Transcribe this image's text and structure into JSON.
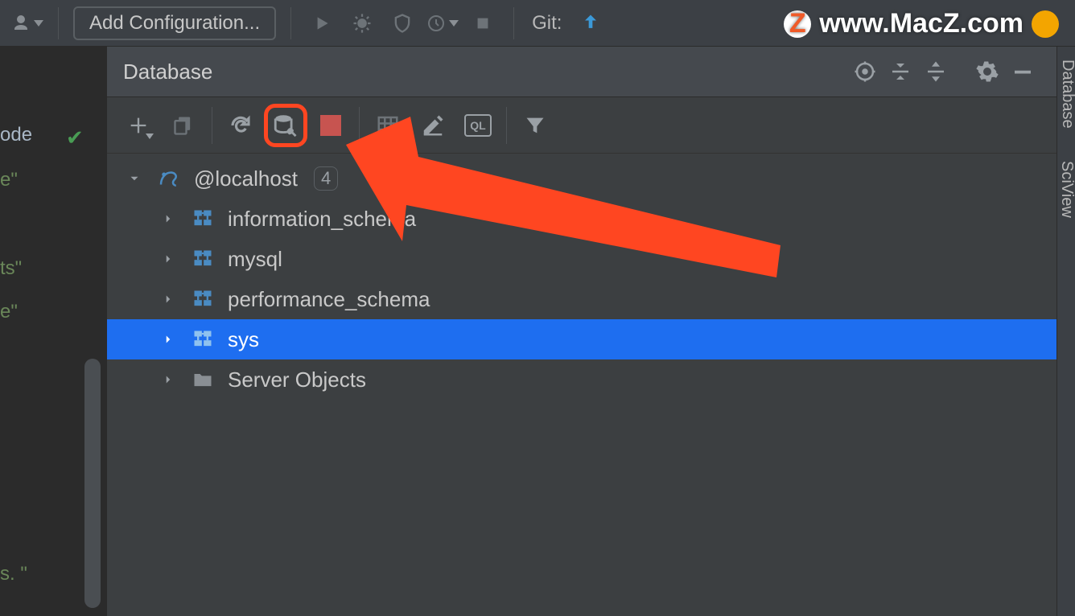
{
  "toolbar": {
    "add_config_label": "Add Configuration...",
    "git_label": "Git:"
  },
  "watermark": {
    "text": "www.MacZ.com",
    "badge_letter": "Z"
  },
  "panel": {
    "title": "Database"
  },
  "db_toolbar": {
    "ql_badge": "QL"
  },
  "tree": {
    "connection": {
      "label": "@localhost",
      "child_count": "4"
    },
    "items": [
      {
        "label": "information_schema",
        "type": "schema",
        "selected": false
      },
      {
        "label": "mysql",
        "type": "schema",
        "selected": false
      },
      {
        "label": "performance_schema",
        "type": "schema",
        "selected": false
      },
      {
        "label": "sys",
        "type": "schema",
        "selected": true
      },
      {
        "label": "Server Objects",
        "type": "folder",
        "selected": false
      }
    ]
  },
  "right_strip": {
    "tab1": "Database",
    "tab2": "SciView"
  },
  "editor": {
    "frag0": "ode",
    "frag1": "e\"",
    "frag2": "ts\"",
    "frag3": "e\"",
    "frag4": "s. \""
  },
  "colors": {
    "selection": "#1e6ef0",
    "annotation": "#ff4621"
  }
}
